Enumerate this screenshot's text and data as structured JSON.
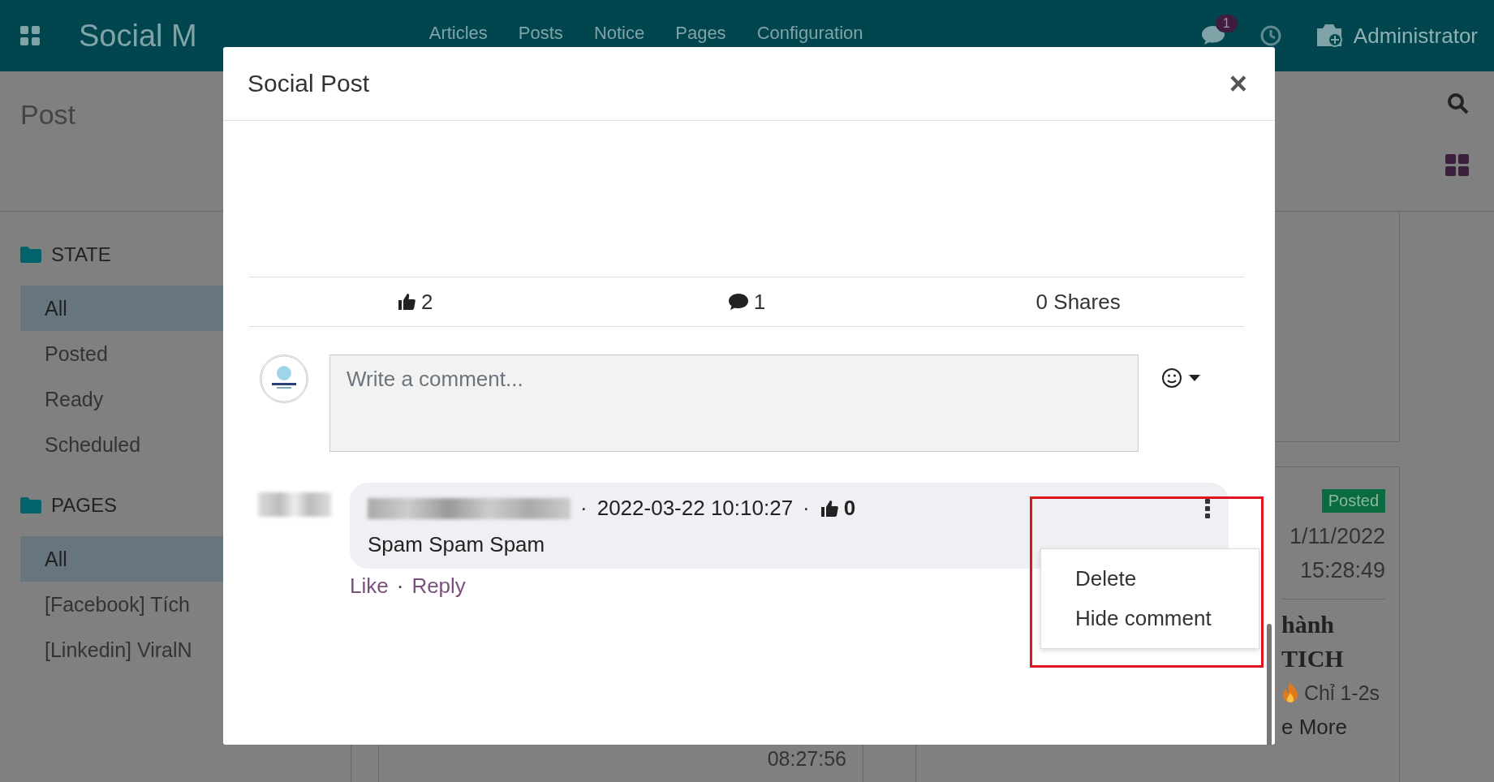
{
  "topbar": {
    "app_title": "Social M",
    "menu": [
      "Articles",
      "Posts",
      "Notice",
      "Pages",
      "Configuration"
    ],
    "messages_badge": "1",
    "user": "Administrator"
  },
  "control_panel": {
    "title": "Post"
  },
  "sidebar": {
    "sections": [
      {
        "title": "STATE",
        "items": [
          {
            "label": "All",
            "selected": true
          },
          {
            "label": "Posted",
            "selected": false
          },
          {
            "label": "Ready",
            "selected": false
          },
          {
            "label": "Scheduled",
            "selected": false
          }
        ]
      },
      {
        "title": "PAGES",
        "items": [
          {
            "label": "All",
            "selected": true
          },
          {
            "label": "[Facebook] Tích",
            "selected": false
          },
          {
            "label": "[Linkedin] ViralN",
            "selected": false
          }
        ]
      }
    ]
  },
  "background_card": {
    "status": "Posted",
    "date": "1/11/2022",
    "time": "15:28:49",
    "title_lines": [
      "hành",
      "TICH"
    ],
    "text": "Chỉ 1-2s",
    "more": "e More"
  },
  "background_column": {
    "time": "08:27:56"
  },
  "modal": {
    "title": "Social Post",
    "close": "×",
    "stats": {
      "likes": "2",
      "comments": "1",
      "shares": "0 Shares"
    },
    "comment_input": {
      "placeholder": "Write a comment..."
    },
    "comments": [
      {
        "separator_1": "·",
        "date": "2022-03-22 10:10:27",
        "separator_2": "·",
        "likes": "0",
        "text": "Spam Spam Spam",
        "actions": [
          "Like",
          "Reply"
        ],
        "actions_separator": "·",
        "menu_open": true,
        "menu": [
          "Delete",
          "Hide comment"
        ]
      }
    ]
  }
}
